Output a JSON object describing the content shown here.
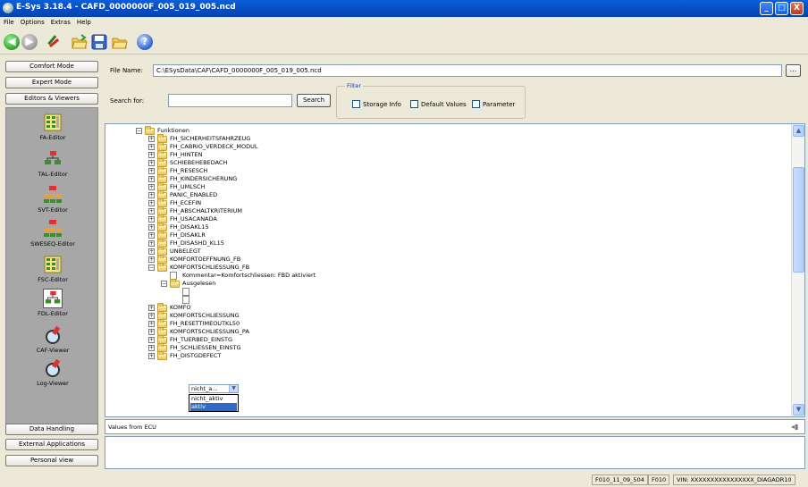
{
  "window": {
    "title": "E-Sys 3.18.4 - CAFD_0000000F_005_019_005.ncd",
    "min": "_",
    "max": "□",
    "close": "X"
  },
  "menu": [
    "File",
    "Options",
    "Extras",
    "Help"
  ],
  "toolbar": {
    "back": "◀",
    "forward": "▶",
    "help": "?"
  },
  "sidebar": {
    "comfort_mode": "Comfort Mode",
    "expert_mode": "Expert Mode",
    "editors_viewers": "Editors & Viewers",
    "tools": [
      {
        "label": "FA-Editor",
        "icon": "grid-icon"
      },
      {
        "label": "TAL-Editor",
        "icon": "tree-icon"
      },
      {
        "label": "SVT-Editor",
        "icon": "hierarchy-icon"
      },
      {
        "label": "SWESEQ-Editor",
        "icon": "hierarchy-icon"
      },
      {
        "label": "FSC-Editor",
        "icon": "grid-icon"
      },
      {
        "label": "FDL-Editor",
        "icon": "tree-icon"
      },
      {
        "label": "CAF-Viewer",
        "icon": "magnifier-icon"
      },
      {
        "label": "Log-Viewer",
        "icon": "magnifier-icon"
      }
    ],
    "data_handling": "Data Handling",
    "external_apps": "External Applications",
    "personal_view": "Personal view"
  },
  "main": {
    "file_name_label": "File Name:",
    "file_name_value": "C:\\ESysData\\CAF\\CAFD_0000000F_005_019_005.ncd",
    "browse_label": "...",
    "search_label": "Search for:",
    "search_value": "",
    "search_button": "Search",
    "filter_legend": "Filter",
    "filter_options": [
      "Storage Info",
      "Default Values",
      "Parameter"
    ]
  },
  "tree": {
    "root": "Funktionen",
    "items_top": [
      "FH_SICHERHEITSFAHRZEUG",
      "FH_CABRIO_VERDECK_MODUL",
      "FH_HINTEN",
      "SCHIEBEHEBEDACH",
      "FH_RESESCH",
      "FH_KINDERSICHERUNG",
      "FH_UMLSCH",
      "PANIC_ENABLED",
      "FH_ECEFIN",
      "FH_ABSCHALTKRITERIUM",
      "FH_USACANADA",
      "FH_DISAKL15",
      "FH_DISAKLR",
      "FH_DISASHD_KL15",
      "UNBELEGT",
      "KOMFORTOEFFNUNG_FB",
      "KOMFORTSCHLIESSUNG_FB"
    ],
    "comment": "Kommentar=Komfortschliessen: FBD aktiviert",
    "ausgelesen": "Ausgelesen",
    "dropdown_value": "nicht_a...",
    "dropdown_options": [
      "nicht_aktiv",
      "aktiv"
    ],
    "item_partial": "KOMFO",
    "items_bottom": [
      "KOMFORTSCHLIESSUNG",
      "FH_RESETTIMEOUTKL50",
      "KOMFORTSCHLIESSUNG_PA",
      "FH_TUERBED_EINSTG",
      "FH_SCHLIESSEN_EINSTG",
      "FH_DISTGDEFECT"
    ]
  },
  "values_panel": {
    "title": "Values from ECU"
  },
  "status": [
    "F010_11_09_504",
    "F010",
    "VIN: XXXXXXXXXXXXXXXX_DIAGADR10"
  ]
}
